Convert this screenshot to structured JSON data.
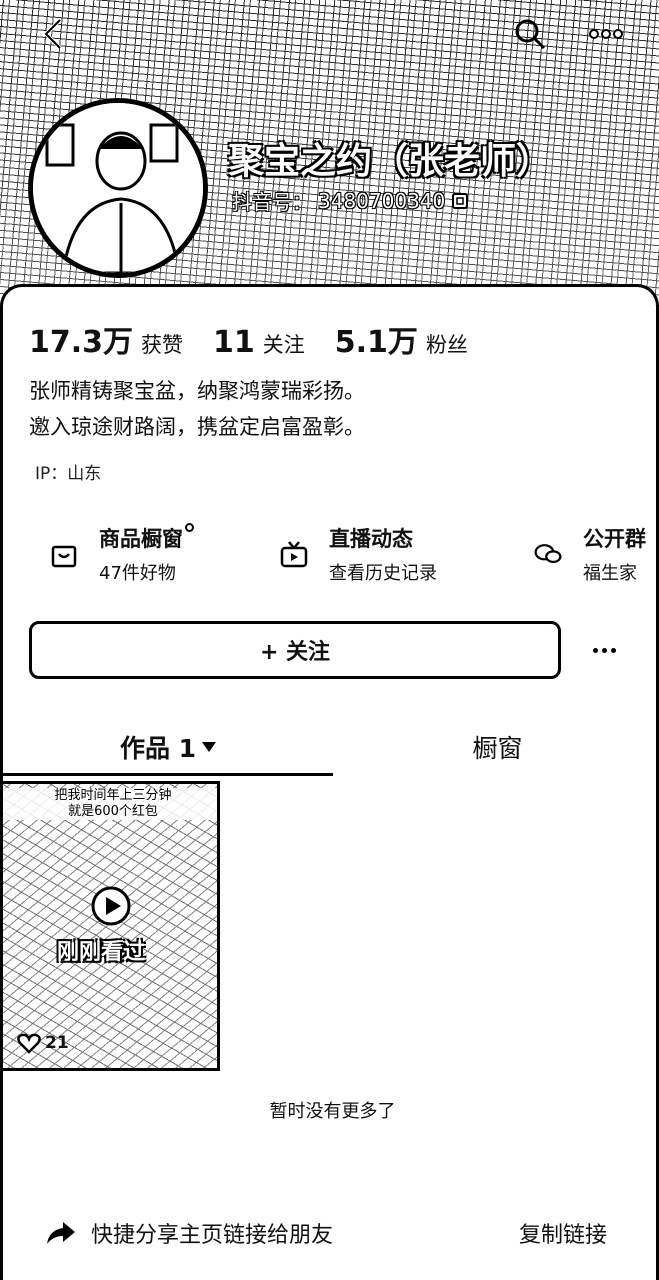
{
  "header": {
    "nickname": "聚宝之约（张老师）",
    "douyin_id_label": "抖音号：",
    "douyin_id": "3480700340"
  },
  "stats": [
    {
      "num": "17.3万",
      "label": "获赞"
    },
    {
      "num": "11",
      "label": "关注"
    },
    {
      "num": "5.1万",
      "label": "粉丝"
    }
  ],
  "bio": {
    "line1": "张师精铸聚宝盆，纳聚鸿蒙瑞彩扬。",
    "line2": "邀入琼途财路阔，携盆定启富盈彰。"
  },
  "ip": "IP：山东",
  "features": [
    {
      "title": "商品橱窗",
      "sub": "47件好物",
      "icon": "bag-icon"
    },
    {
      "title": "直播动态",
      "sub": "查看历史记录",
      "icon": "tv-icon"
    },
    {
      "title": "公开群",
      "sub": "福生家",
      "icon": "chat-icon"
    }
  ],
  "follow_button": "+ 关注",
  "tabs": {
    "works": "作品 1",
    "showcase": "橱窗"
  },
  "video": {
    "caption_line1": "把我时间年上三分钟",
    "caption_line2": "就是600个红包",
    "watched_label": "刚刚看过",
    "likes": "21"
  },
  "no_more": "暂时没有更多了",
  "share": {
    "label": "快捷分享主页链接给朋友",
    "copy": "复制链接"
  }
}
